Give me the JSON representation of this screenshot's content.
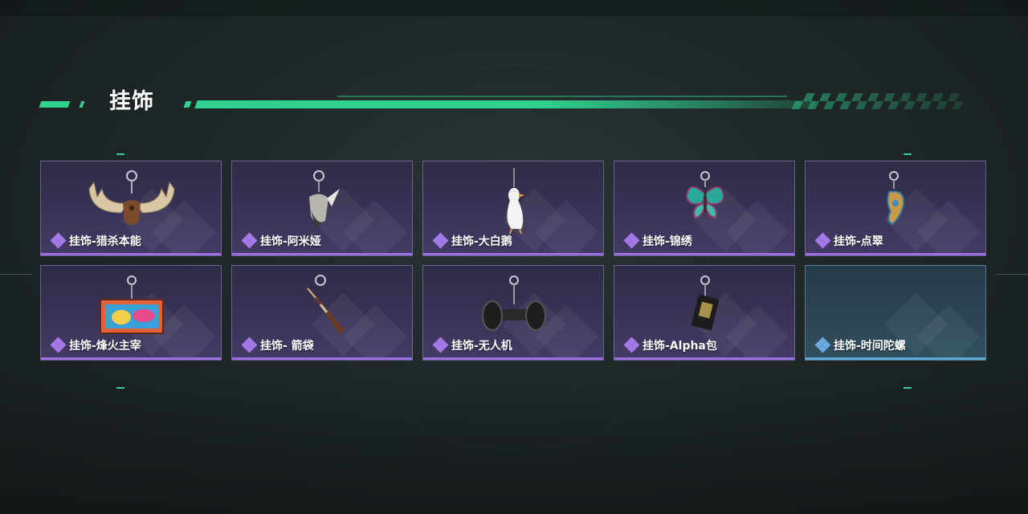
{
  "section": {
    "title": "挂饰",
    "accent_color": "#2fd38f"
  },
  "rarity_colors": {
    "purple": "#9b6fe0",
    "blue": "#5ea8d8"
  },
  "items": [
    {
      "label": "挂饰-猎杀本能",
      "rarity": "purple",
      "icon": "moose-antler-charm-icon"
    },
    {
      "label": "挂饰-阿米娅",
      "rarity": "purple",
      "icon": "bird-charm-icon"
    },
    {
      "label": "挂饰-大白鹅",
      "rarity": "purple",
      "icon": "white-goose-charm-icon"
    },
    {
      "label": "挂饰-锦绣",
      "rarity": "purple",
      "icon": "butterfly-charm-icon"
    },
    {
      "label": "挂饰-点翠",
      "rarity": "purple",
      "icon": "jade-ornament-charm-icon"
    },
    {
      "label": "挂饰-烽火主宰",
      "rarity": "purple",
      "icon": "graffiti-container-charm-icon"
    },
    {
      "label": "挂饰- 箭袋",
      "rarity": "purple",
      "icon": "quiver-charm-icon"
    },
    {
      "label": "挂饰-无人机",
      "rarity": "purple",
      "icon": "drone-charm-icon"
    },
    {
      "label": "挂饰-Alpha包",
      "rarity": "purple",
      "icon": "alpha-pack-charm-icon"
    },
    {
      "label": "挂饰-时间陀螺",
      "rarity": "blue",
      "icon": "time-gyro-charm-icon"
    }
  ]
}
